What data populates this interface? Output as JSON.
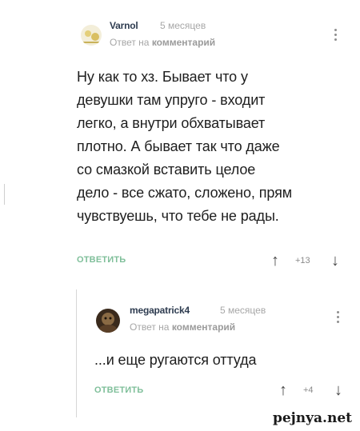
{
  "comments": [
    {
      "username": "Varnol",
      "time": "5 месяцев",
      "reply_prefix": "Ответ на",
      "reply_target": "комментарий",
      "text": "Ну как то хз. Бывает что у\nдевушки там упруго - входит\nлегко, а внутри обхватывает\nплотно. А бывает так что даже\nсо смазкой вставить целое\nдело - все сжато, сложено, прям\nчувствуешь, что тебе не рады.",
      "reply_label": "ОТВЕТИТЬ",
      "score": "+13",
      "upvote_icon": "up-arrow-icon",
      "downvote_icon": "down-arrow-icon"
    },
    {
      "username": "megapatrick4",
      "time": "5 месяцев",
      "reply_prefix": "Ответ на",
      "reply_target": "комментарий",
      "text": "...и еще ругаются оттуда",
      "reply_label": "ОТВЕТИТЬ",
      "score": "+4",
      "upvote_icon": "up-arrow-icon",
      "downvote_icon": "down-arrow-icon"
    }
  ],
  "watermark": "pejnya.net",
  "colors": {
    "reply_button": "#7fbf9a",
    "username": "#2e3c50",
    "meta": "#a6a6a6",
    "text": "#1e1e1e"
  }
}
